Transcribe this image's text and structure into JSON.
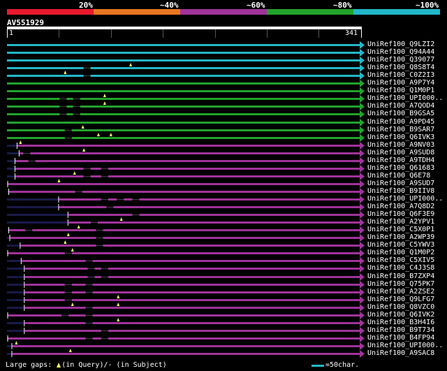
{
  "legend": {
    "segments": [
      {
        "label": "20%",
        "color": "#e8192c"
      },
      {
        "label": "~40%",
        "color": "#e87722"
      },
      {
        "label": "~60%",
        "color": "#a0339a"
      },
      {
        "label": "~80%",
        "color": "#22a32c"
      },
      {
        "label": "~100%",
        "color": "#22b8c8"
      }
    ]
  },
  "query": {
    "id": "AV551929",
    "start": "1",
    "end": "341",
    "length": 341
  },
  "colors": {
    "cyan": "#22b8c8",
    "green": "#22a32c",
    "purple": "#a0339a",
    "gap_marker": "#ffff66",
    "unaligned": "#1a1a4a",
    "connector": "#ffffff"
  },
  "hits": [
    {
      "label": "UniRef100_Q9LZI2",
      "color": "cyan",
      "start": 1,
      "end": 341,
      "query_gaps": [],
      "subject_gaps": []
    },
    {
      "label": "UniRef100_Q94A44",
      "color": "cyan",
      "start": 1,
      "end": 341,
      "query_gaps": [],
      "subject_gaps": []
    },
    {
      "label": "UniRef100_Q39077",
      "color": "cyan",
      "start": 1,
      "end": 341,
      "query_gaps": [],
      "subject_gaps": []
    },
    {
      "label": "UniRef100_Q8S8T4",
      "color": "cyan",
      "start": 1,
      "end": 341,
      "query_gaps": [
        120
      ],
      "subject_gaps": [
        78
      ]
    },
    {
      "label": "UniRef100_C0Z2I3",
      "color": "cyan",
      "start": 1,
      "end": 341,
      "query_gaps": [
        57
      ],
      "subject_gaps": [
        78
      ]
    },
    {
      "label": "UniRef100_A9P7Y4",
      "color": "green",
      "start": 1,
      "end": 341,
      "query_gaps": [],
      "subject_gaps": []
    },
    {
      "label": "UniRef100_Q1M0P1",
      "color": "green",
      "start": 1,
      "end": 341,
      "query_gaps": [],
      "subject_gaps": []
    },
    {
      "label": "UniRef100_UPI000..",
      "color": "green",
      "start": 1,
      "end": 341,
      "query_gaps": [
        95
      ],
      "subject_gaps": [
        55,
        68
      ]
    },
    {
      "label": "UniRef100_A7QOD4",
      "color": "green",
      "start": 1,
      "end": 341,
      "query_gaps": [
        95
      ],
      "subject_gaps": [
        55,
        68
      ]
    },
    {
      "label": "UniRef100_B9GSA5",
      "color": "green",
      "start": 1,
      "end": 341,
      "query_gaps": [],
      "subject_gaps": [
        55,
        68
      ]
    },
    {
      "label": "UniRef100_A9PD45",
      "color": "green",
      "start": 1,
      "end": 341,
      "query_gaps": [],
      "subject_gaps": []
    },
    {
      "label": "UniRef100_B9SAR7",
      "color": "green",
      "start": 1,
      "end": 341,
      "query_gaps": [
        74
      ],
      "subject_gaps": [
        60
      ]
    },
    {
      "label": "UniRef100_Q6IVK3",
      "color": "green",
      "start": 1,
      "end": 341,
      "query_gaps": [
        89,
        101
      ],
      "subject_gaps": [
        60
      ]
    },
    {
      "label": "UniRef100_A9NV03",
      "color": "purple",
      "start": 11,
      "end": 341,
      "query_gaps": [
        14
      ],
      "subject_gaps": []
    },
    {
      "label": "UniRef100_A9SUD8",
      "color": "purple",
      "start": 13,
      "end": 341,
      "query_gaps": [
        75
      ],
      "subject_gaps": [
        20
      ]
    },
    {
      "label": "UniRef100_A9TDH4",
      "color": "purple",
      "start": 9,
      "end": 341,
      "query_gaps": [],
      "subject_gaps": [
        25
      ]
    },
    {
      "label": "UniRef100_Q61683",
      "color": "purple",
      "start": 9,
      "end": 341,
      "query_gaps": [],
      "subject_gaps": [
        78,
        95
      ]
    },
    {
      "label": "UniRef100_Q6E78",
      "color": "purple",
      "start": 9,
      "end": 341,
      "query_gaps": [
        66
      ],
      "subject_gaps": [
        78,
        95
      ]
    },
    {
      "label": "UniRef100_A9SUD7",
      "color": "purple",
      "start": 2,
      "end": 341,
      "query_gaps": [
        51
      ],
      "subject_gaps": []
    },
    {
      "label": "UniRef100_B9IIV8",
      "color": "purple",
      "start": 3,
      "end": 341,
      "query_gaps": [],
      "subject_gaps": [
        70
      ]
    },
    {
      "label": "UniRef100_UPI000..",
      "color": "purple",
      "start": 51,
      "end": 341,
      "query_gaps": [],
      "subject_gaps": [
        95,
        110,
        125
      ]
    },
    {
      "label": "UniRef100_A7Q8D2",
      "color": "purple",
      "start": 51,
      "end": 341,
      "query_gaps": [],
      "subject_gaps": [
        100
      ]
    },
    {
      "label": "UniRef100_Q6F3E9",
      "color": "purple",
      "start": 60,
      "end": 341,
      "query_gaps": [],
      "subject_gaps": [
        125
      ]
    },
    {
      "label": "UniRef100_A2YPV1",
      "color": "purple",
      "start": 60,
      "end": 341,
      "query_gaps": [
        111
      ],
      "subject_gaps": [
        85
      ]
    },
    {
      "label": "UniRef100_C5X0P1",
      "color": "purple",
      "start": 3,
      "end": 341,
      "query_gaps": [
        70
      ],
      "subject_gaps": [
        22,
        90
      ]
    },
    {
      "label": "UniRef100_A2WP39",
      "color": "purple",
      "start": 4,
      "end": 341,
      "query_gaps": [
        60
      ],
      "subject_gaps": [
        90
      ]
    },
    {
      "label": "UniRef100_C5YWV3",
      "color": "purple",
      "start": 14,
      "end": 341,
      "query_gaps": [
        57
      ],
      "subject_gaps": [
        90
      ]
    },
    {
      "label": "UniRef100_Q1M0P2",
      "color": "purple",
      "start": 2,
      "end": 341,
      "query_gaps": [
        64
      ],
      "subject_gaps": [
        60
      ]
    },
    {
      "label": "UniRef100_C5XIV5",
      "color": "purple",
      "start": 15,
      "end": 341,
      "query_gaps": [],
      "subject_gaps": [
        80
      ]
    },
    {
      "label": "UniRef100_C4J3S8",
      "color": "purple",
      "start": 18,
      "end": 341,
      "query_gaps": [],
      "subject_gaps": [
        82,
        95
      ]
    },
    {
      "label": "UniRef100_B7ZXP4",
      "color": "purple",
      "start": 18,
      "end": 341,
      "query_gaps": [],
      "subject_gaps": [
        82,
        95
      ]
    },
    {
      "label": "UniRef100_Q75PK7",
      "color": "purple",
      "start": 18,
      "end": 341,
      "query_gaps": [],
      "subject_gaps": [
        60,
        80
      ]
    },
    {
      "label": "UniRef100_A2ZSE2",
      "color": "purple",
      "start": 18,
      "end": 341,
      "query_gaps": [],
      "subject_gaps": [
        60,
        80
      ]
    },
    {
      "label": "UniRef100_Q9LFG7",
      "color": "purple",
      "start": 18,
      "end": 341,
      "query_gaps": [
        108
      ],
      "subject_gaps": [
        60
      ]
    },
    {
      "label": "UniRef100_Q8VZC0",
      "color": "purple",
      "start": 18,
      "end": 341,
      "query_gaps": [
        64,
        108
      ],
      "subject_gaps": [
        80
      ]
    },
    {
      "label": "UniRef100_Q6IVK2",
      "color": "purple",
      "start": 2,
      "end": 341,
      "query_gaps": [],
      "subject_gaps": [
        57,
        80
      ]
    },
    {
      "label": "UniRef100_B3H4I6",
      "color": "purple",
      "start": 18,
      "end": 341,
      "query_gaps": [
        108
      ],
      "subject_gaps": [
        80
      ]
    },
    {
      "label": "UniRef100_B9T734",
      "color": "purple",
      "start": 18,
      "end": 341,
      "query_gaps": [],
      "subject_gaps": [
        95
      ]
    },
    {
      "label": "UniRef100_B4FP94",
      "color": "purple",
      "start": 2,
      "end": 341,
      "query_gaps": [],
      "subject_gaps": [
        80,
        95
      ]
    },
    {
      "label": "UniRef100_UPI000..",
      "color": "purple",
      "start": 6,
      "end": 341,
      "query_gaps": [
        10
      ],
      "subject_gaps": []
    },
    {
      "label": "UniRef100_A9SAC8",
      "color": "purple",
      "start": 6,
      "end": 341,
      "query_gaps": [
        62
      ],
      "subject_gaps": []
    }
  ],
  "footer": {
    "large_gaps_prefix": "Large gaps:",
    "large_gaps_suffix": "(in Query)/- (in Subject)",
    "scale_label": "=50char."
  }
}
